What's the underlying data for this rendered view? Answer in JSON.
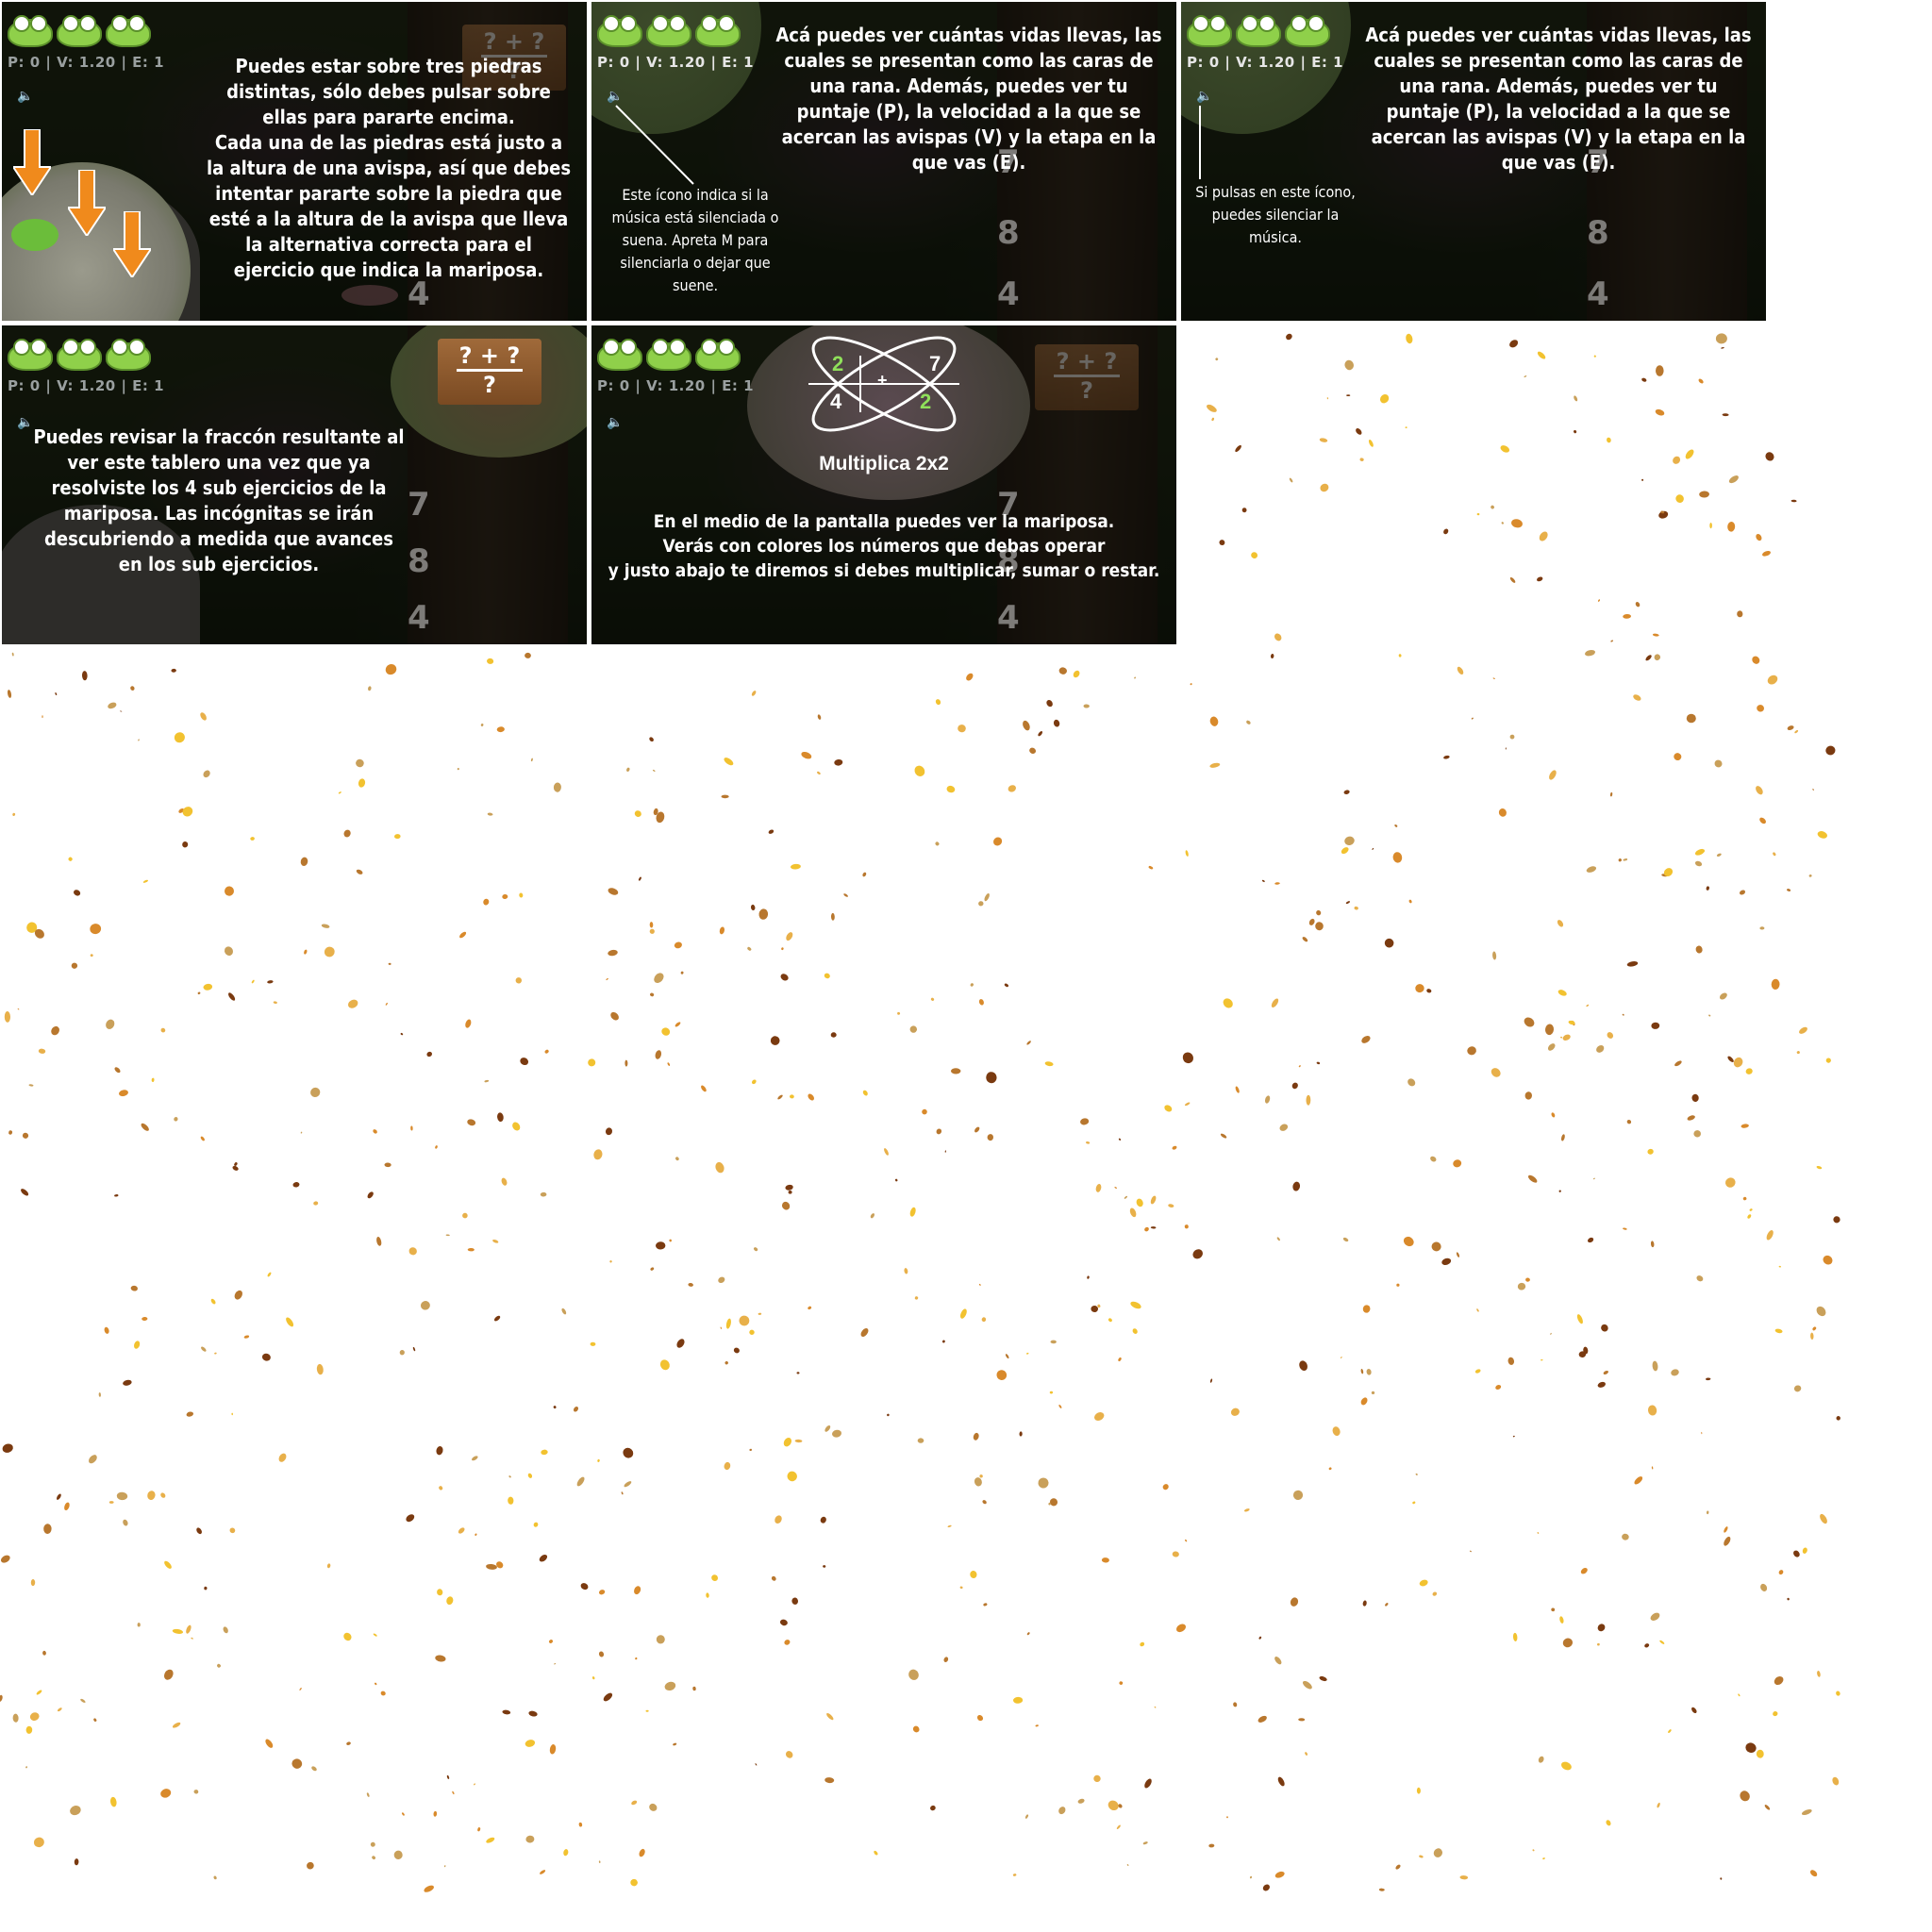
{
  "hud": {
    "stats": "P: 0 | V: 1.20 | E: 1",
    "speaker_icon": "speaker-icon",
    "life_icon": "frog-face-icon"
  },
  "sign": {
    "top": "? + ?",
    "bottom": "?"
  },
  "butterfly": {
    "n1": "2",
    "n2": "7",
    "n3": "4",
    "n4": "2",
    "op": "+",
    "label": "Multiplica 2x2"
  },
  "wasp_numbers": [
    "7",
    "8",
    "4"
  ],
  "panels": {
    "p1": {
      "text": [
        "Puedes estar sobre tres piedras",
        "distintas, sólo debes pulsar sobre",
        "ellas para pararte encima.",
        "Cada una de las piedras está justo a",
        "la altura de una avispa, así que debes",
        "intentar pararte sobre la piedra que",
        "esté a la altura de la avispa que lleva",
        "la alternativa correcta para el",
        "ejercicio que indica la mariposa."
      ]
    },
    "p2": {
      "text": [
        "Acá puedes ver cuántas vidas llevas, las",
        "cuales se presentan como las caras de",
        "una rana. Además, puedes ver tu",
        "puntaje (P), la velocidad a la que se",
        "acercan las avispas (V) y la etapa en la",
        "que vas (E)."
      ],
      "note": [
        "Este ícono indica si la",
        "música está silenciada o",
        "suena. Apreta M para",
        "silenciarla o dejar que",
        "suene."
      ]
    },
    "p3": {
      "text": [
        "Acá puedes ver cuántas vidas llevas, las",
        "cuales se presentan como las caras de",
        "una rana. Además, puedes ver tu",
        "puntaje (P), la velocidad a la que se",
        "acercan las avispas (V) y la etapa en la",
        "que vas (E)."
      ],
      "note": [
        "Si pulsas en este ícono,",
        "puedes silenciar la",
        "música."
      ]
    },
    "p4": {
      "text": [
        "Puedes revisar la fraccón resultante al",
        "ver este tablero una vez que ya",
        "resolviste los 4 sub ejercicios de la",
        "mariposa. Las incógnitas se irán",
        "descubriendo a medida que avances",
        "en los sub ejercicios."
      ]
    },
    "p5": {
      "text": [
        "En el medio de la pantalla puedes ver la mariposa.",
        "Verás con colores los números que debas operar",
        "y justo abajo te diremos si debes multiplicar, sumar o restar."
      ]
    }
  },
  "colors": {
    "text": "#ffffff",
    "overlay": "rgba(0,0,0,0.68)",
    "arrow": "#f08a1c",
    "frog": "#8fd04a"
  }
}
